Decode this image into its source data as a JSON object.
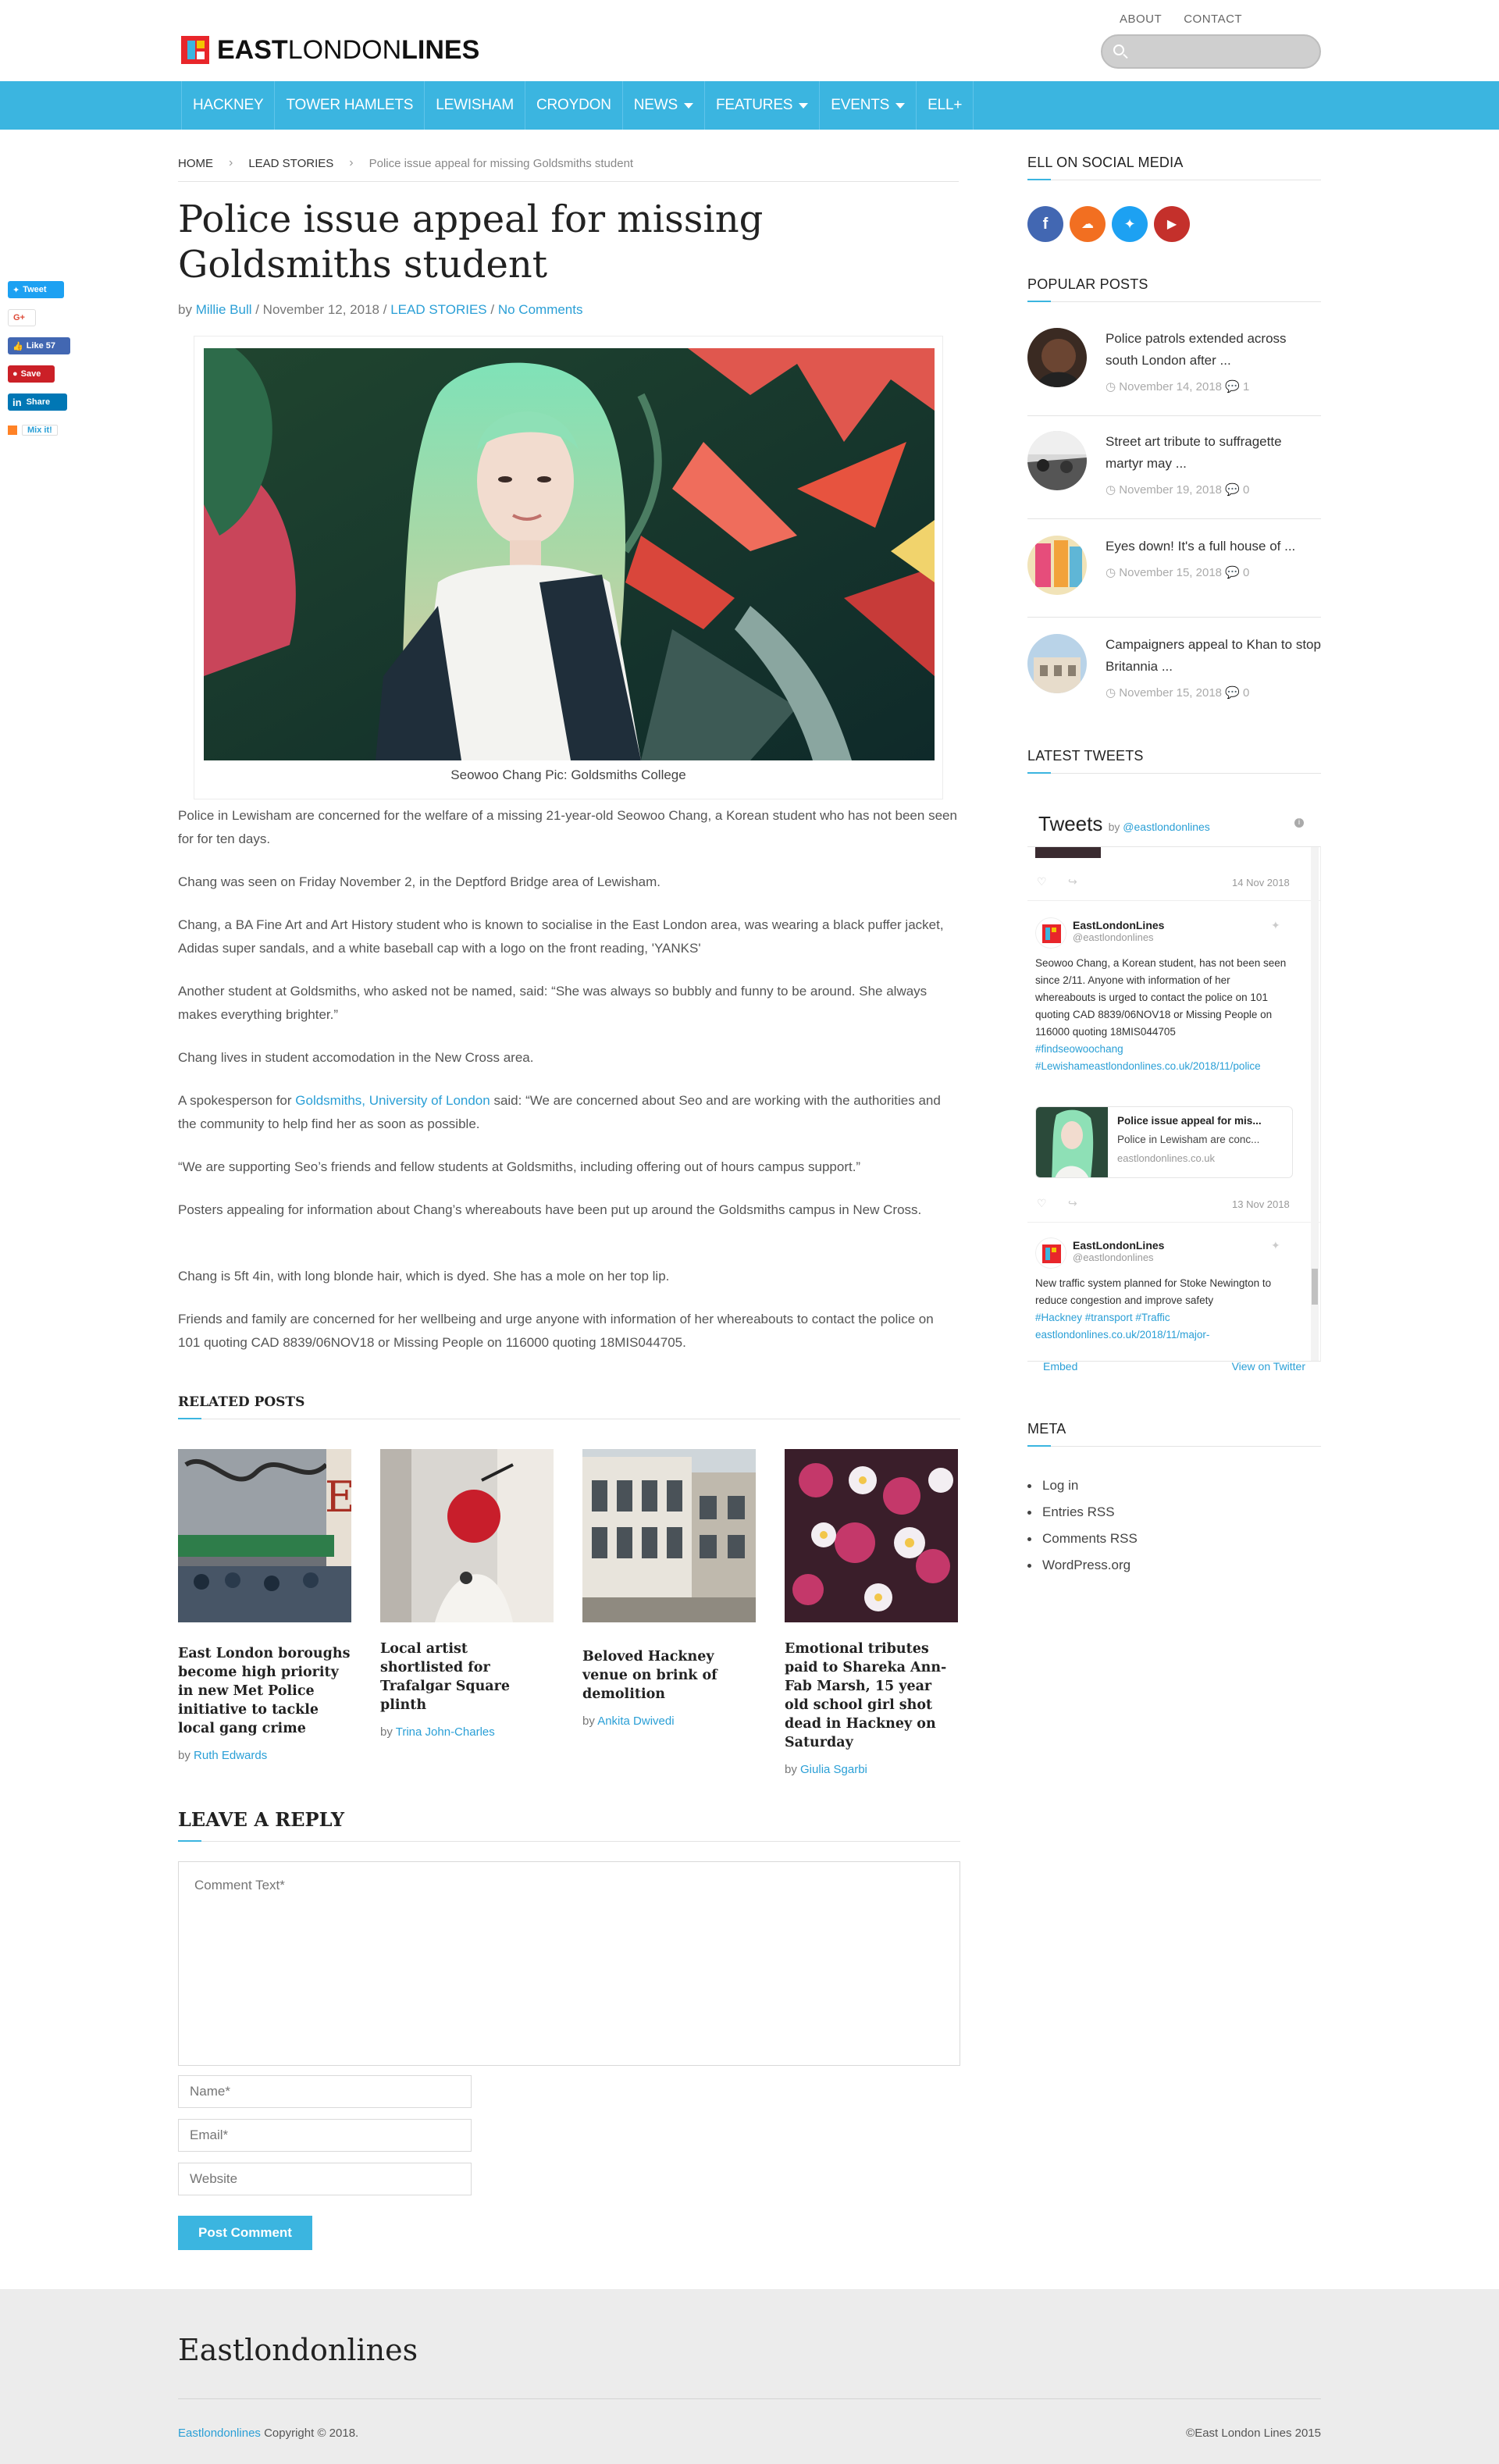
{
  "site": {
    "logo_bold": "EAST",
    "logo_thin": "LONDON",
    "logo_bold2": "LINES",
    "top_links": [
      "ABOUT",
      "CONTACT"
    ],
    "search_placeholder": ""
  },
  "nav": {
    "items": [
      "HACKNEY",
      "TOWER HAMLETS",
      "LEWISHAM",
      "CROYDON",
      "NEWS",
      "FEATURES",
      "EVENTS",
      "ELL+"
    ]
  },
  "share": {
    "tweet": "Tweet",
    "gplus": "G+",
    "like": "Like 57",
    "save": "Save",
    "linkedin": "Share",
    "mix": "Mix it!"
  },
  "breadcrumb": {
    "home": "HOME",
    "section": "LEAD STORIES",
    "current": "Police issue appeal for missing Goldsmiths student"
  },
  "post": {
    "title": "Police issue appeal for missing Goldsmiths student",
    "by": "by",
    "author": "Millie Bull",
    "date": "/ November 12, 2018 /",
    "category": "LEAD STORIES",
    "slash": "/",
    "comments": "No Comments",
    "caption": "Seowoo Chang Pic: Goldsmiths College",
    "paragraphs": [
      "Police in Lewisham are concerned for the welfare of a missing 21-year-old Seowoo Chang, a Korean student who has not been seen for for ten days.",
      "Chang was seen on Friday November 2, in the Deptford Bridge area of Lewisham.",
      "Chang, a BA Fine Art and Art History student who is known to socialise in the East London area, was wearing a black puffer jacket, Adidas super sandals, and a white baseball cap with a logo on the front reading, 'YANKS'",
      "Another student at Goldsmiths, who asked not be named, said: “She was always so bubbly and funny to be around. She always makes everything brighter.”",
      "Chang lives in student accomodation in the New Cross area.",
      "“We are supporting Seo’s friends and fellow students at Goldsmiths, including offering out of hours campus support.”",
      "Posters appealing for information about Chang’s whereabouts have been put up around the Goldsmiths campus in New Cross.",
      "Chang is  5ft 4in, with long blonde hair, which is dyed. She has a mole on her top lip.",
      "Friends and family are concerned for her wellbeing and urge anyone with information of her whereabouts to contact the police on 101 quoting CAD 8839/06NOV18 or Missing People on 116000 quoting 18MIS044705."
    ],
    "spokes_pre": "A spokesperson for ",
    "spokes_link": "Goldsmiths, University of London",
    "spokes_post": " said: “We are concerned about Seo and are working with the authorities and the community to help find her as soon as possible."
  },
  "related": {
    "heading": "RELATED POSTS",
    "items": [
      {
        "title": "East London boroughs become high priority in new Met Police initiative to tackle local gang crime",
        "by": "by",
        "author": "Ruth Edwards"
      },
      {
        "title": "Local artist shortlisted for Trafalgar Square plinth",
        "by": "by",
        "author": "Trina John-Charles"
      },
      {
        "title": "Beloved Hackney venue on brink of demolition",
        "by": "by",
        "author": "Ankita Dwivedi"
      },
      {
        "title": "Emotional tributes paid to Shareka Ann-Fab Marsh, 15 year old school girl shot dead in Hackney on Saturday",
        "by": "by",
        "author": "Giulia Sgarbi"
      }
    ]
  },
  "reply": {
    "heading": "LEAVE A REPLY",
    "comment_placeholder": "Comment Text*",
    "name_placeholder": "Name*",
    "email_placeholder": "Email*",
    "website_placeholder": "Website",
    "button": "Post Comment"
  },
  "sidebar": {
    "social_heading": "ELL ON SOCIAL MEDIA",
    "social_icons": [
      "facebook-icon",
      "soundcloud-icon",
      "twitter-icon",
      "youtube-icon"
    ],
    "popular_heading": "POPULAR POSTS",
    "popular": [
      {
        "title": "Police patrols extended across south London after ...",
        "date": "November 14, 2018",
        "comments": "1"
      },
      {
        "title": "Street art tribute to suffragette martyr may ...",
        "date": "November 19, 2018",
        "comments": "0"
      },
      {
        "title": "Eyes down! It's a full house of ...",
        "date": "November 15, 2018",
        "comments": "0"
      },
      {
        "title": "Campaigners appeal to Khan to stop Britannia ...",
        "date": "November 15, 2018",
        "comments": "0"
      }
    ],
    "tweets_heading": "LATEST TWEETS",
    "meta_heading": "META",
    "meta_links": [
      "Log in",
      "Entries RSS",
      "Comments RSS",
      "WordPress.org"
    ]
  },
  "tweets": {
    "title": "Tweets",
    "by": "by",
    "handle_link": "@eastlondonlines",
    "date1": "14 Nov 2018",
    "name": "EastLondonLines",
    "handle": "@eastlondonlines",
    "t1_text": "Seowoo Chang, a Korean student, has not been seen since 2/11. Anyone with information of her whereabouts is urged to contact the police on 101 quoting CAD 8839/06NOV18 or Missing People on 116000 quoting 18MIS044705",
    "t1_tag1": "#findseowoochang",
    "t1_tag2": "#Lewishameastlondonlines.co.uk/2018/11/police",
    "card_title": "Police issue appeal for mis...",
    "card_desc": "Police in Lewisham are conc...",
    "card_domain": "eastlondonlines.co.uk",
    "date2": "13 Nov 2018",
    "t2_text": "New traffic system planned for Stoke Newington to reduce congestion and improve safety",
    "t2_tags": "#Hackney #transport #Traffic",
    "t2_link": "eastlondonlines.co.uk/2018/11/major-",
    "embed": "Embed",
    "view": "View on Twitter"
  },
  "footer": {
    "title": "Eastlondonlines",
    "left_link": "Eastlondonlines",
    "left_text": " Copyright © 2018.",
    "right": "©East London Lines 2015"
  },
  "colors": {
    "accent": "#3bb5e0",
    "link": "#2a9fd6",
    "footer_bg": "#ececec"
  }
}
